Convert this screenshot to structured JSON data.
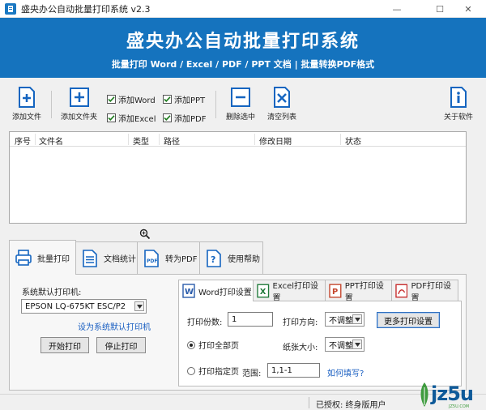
{
  "window": {
    "title": "盛央办公自动批量打印系统 v2.3",
    "controls": {
      "minimize": "—",
      "maximize": "☐",
      "close": "✕"
    }
  },
  "banner": {
    "title": "盛央办公自动批量打印系统",
    "subtitle": "批量打印 Word / Excel / PDF / PPT 文档  |  批量转换PDF格式",
    "background": "#1573be"
  },
  "toolbar": {
    "add_file": "添加文件",
    "add_folder": "添加文件夹",
    "delete_selected": "删除选中",
    "clear_list": "清空列表",
    "about": "关于软件",
    "checkboxes": [
      {
        "label": "添加Word",
        "checked": true
      },
      {
        "label": "添加PPT",
        "checked": true
      },
      {
        "label": "添加Excel",
        "checked": true
      },
      {
        "label": "添加PDF",
        "checked": true
      }
    ]
  },
  "file_list": {
    "columns": [
      "序号",
      "文件名",
      "类型",
      "路径",
      "修改日期",
      "状态"
    ],
    "rows": []
  },
  "main_tabs": [
    {
      "label": "批量打印",
      "icon": "printer-icon",
      "active": true
    },
    {
      "label": "文档统计",
      "icon": "document-icon",
      "active": false
    },
    {
      "label": "转为PDF",
      "icon": "pdf-icon",
      "active": false
    },
    {
      "label": "使用帮助",
      "icon": "help-icon",
      "active": false
    }
  ],
  "printer": {
    "label": "系统默认打印机:",
    "selected": "EPSON LQ-675KT ESC/P2",
    "set_default_link": "设为系统默认打印机",
    "start_button": "开始打印",
    "stop_button": "停止打印"
  },
  "settings_tabs": [
    {
      "label": "Word打印设置",
      "icon": "word-icon",
      "active": true
    },
    {
      "label": "Excel打印设置",
      "icon": "excel-icon",
      "active": false
    },
    {
      "label": "PPT打印设置",
      "icon": "ppt-icon",
      "active": false
    },
    {
      "label": "PDF打印设置",
      "icon": "pdf-file-icon",
      "active": false
    }
  ],
  "word_settings": {
    "copies_label": "打印份数:",
    "copies_value": "1",
    "orientation_label": "打印方向:",
    "orientation_value": "不调整",
    "more_button": "更多打印设置",
    "print_all_label": "打印全部页",
    "print_all_checked": true,
    "paper_size_label": "纸张大小:",
    "paper_size_value": "不调整",
    "print_range_label": "打印指定页",
    "print_range_checked": false,
    "range_label": "范围:",
    "range_value": "1,1-1",
    "how_to_link": "如何填写?"
  },
  "status": {
    "license": "已授权:  终身版用户"
  },
  "watermark": {
    "text": "jz5u",
    "small": "JZ5U.COM"
  }
}
